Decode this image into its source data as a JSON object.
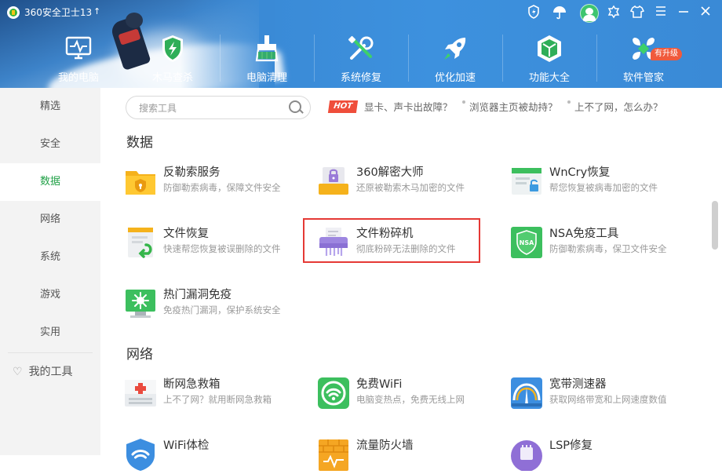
{
  "app": {
    "title": "360安全卫士13",
    "upgrade_arrow": "↑"
  },
  "window_controls": {
    "shield": "shield-icon",
    "umbrella": "umbrella-icon",
    "skin": "skin-icon",
    "shirt": "shirt-icon",
    "menu": "menu-icon",
    "minimize": "minimize-icon",
    "close": "close-icon"
  },
  "nav": {
    "items": [
      {
        "label": "我的电脑",
        "icon": "monitor-icon"
      },
      {
        "label": "木马查杀",
        "icon": "shield-bolt-icon"
      },
      {
        "label": "电脑清理",
        "icon": "broom-icon"
      },
      {
        "label": "系统修复",
        "icon": "tools-icon"
      },
      {
        "label": "优化加速",
        "icon": "rocket-icon"
      },
      {
        "label": "功能大全",
        "icon": "cube-icon"
      },
      {
        "label": "软件管家",
        "icon": "apps-icon"
      }
    ],
    "badge": "有升级"
  },
  "sidebar": {
    "items": [
      {
        "label": "精选"
      },
      {
        "label": "安全"
      },
      {
        "label": "数据"
      },
      {
        "label": "网络"
      },
      {
        "label": "系统"
      },
      {
        "label": "游戏"
      },
      {
        "label": "实用"
      }
    ],
    "active": "数据",
    "my_tools": "我的工具"
  },
  "search": {
    "placeholder": "搜索工具"
  },
  "hot": {
    "badge": "HOT",
    "links": [
      "显卡、声卡出故障？",
      "浏览器主页被劫持？",
      "上不了网，怎么办？"
    ]
  },
  "sections": [
    {
      "title": "数据",
      "tools": [
        {
          "name": "反勒索服务",
          "desc": "防御勒索病毒，保障文件安全",
          "icon": "folder-shield-icon"
        },
        {
          "name": "360解密大师",
          "desc": "还原被勒索木马加密的文件",
          "icon": "lock-drive-icon"
        },
        {
          "name": "WnCry恢复",
          "desc": "帮您恢复被病毒加密的文件",
          "icon": "window-lock-icon"
        },
        {
          "name": "文件恢复",
          "desc": "快速帮您恢复被误删除的文件",
          "icon": "file-restore-icon"
        },
        {
          "name": "文件粉碎机",
          "desc": "彻底粉碎无法删除的文件",
          "icon": "shredder-icon"
        },
        {
          "name": "NSA免疫工具",
          "desc": "防御勒索病毒，保卫文件安全",
          "icon": "nsa-shield-icon"
        },
        {
          "name": "热门漏洞免疫",
          "desc": "免疫热门漏洞，保护系统安全",
          "icon": "virus-monitor-icon"
        }
      ]
    },
    {
      "title": "网络",
      "tools": [
        {
          "name": "断网急救箱",
          "desc": "上不了网？就用断网急救箱",
          "icon": "first-aid-icon"
        },
        {
          "name": "免费WiFi",
          "desc": "电脑变热点，免费无线上网",
          "icon": "wifi-share-icon"
        },
        {
          "name": "宽带测速器",
          "desc": "获取网络带宽和上网速度数值",
          "icon": "speedometer-icon"
        },
        {
          "name": "WiFi体检",
          "desc": "",
          "icon": "wifi-check-icon"
        },
        {
          "name": "流量防火墙",
          "desc": "",
          "icon": "firewall-icon"
        },
        {
          "name": "LSP修复",
          "desc": "",
          "icon": "lsp-icon"
        }
      ]
    }
  ],
  "colors": {
    "accent_green": "#22a148",
    "header_blue": "#3a8ad6",
    "hot_red": "#ef4e3b",
    "highlight_red": "#e53935"
  }
}
